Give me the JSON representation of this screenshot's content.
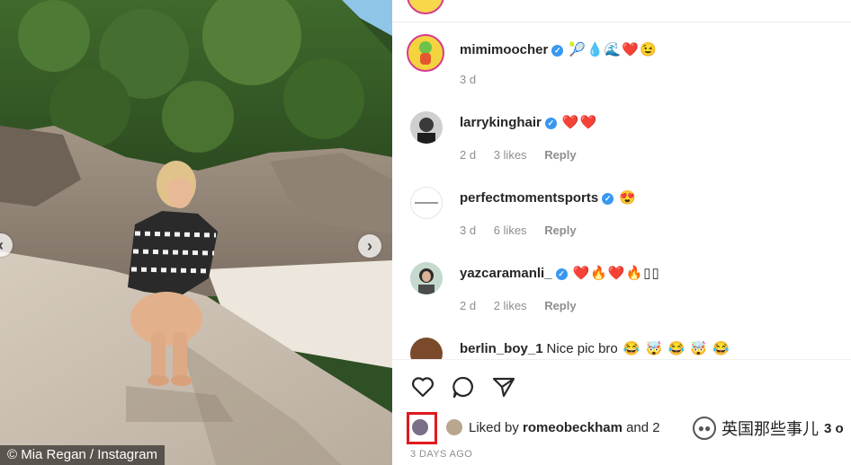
{
  "photo": {
    "watermark": "© Mia Regan / Instagram",
    "nav_left": "‹",
    "nav_right": "›"
  },
  "comments": [
    {
      "username": "mimimoocher",
      "verified": true,
      "text": "",
      "emojis": "🎾💧🌊❤️😉",
      "time": "3 d",
      "likes": "",
      "reply": ""
    },
    {
      "username": "larrykinghair",
      "verified": true,
      "text": "",
      "emojis": "❤️❤️",
      "time": "2 d",
      "likes": "3 likes",
      "reply": "Reply"
    },
    {
      "username": "perfectmomentsports",
      "verified": true,
      "text": "",
      "emojis": "😍",
      "time": "3 d",
      "likes": "6 likes",
      "reply": "Reply"
    },
    {
      "username": "yazcaramanli_",
      "verified": true,
      "text": "",
      "emojis": "❤️🔥❤️🔥▯▯",
      "time": "2 d",
      "likes": "2 likes",
      "reply": "Reply"
    },
    {
      "username": "berlin_boy_1",
      "verified": false,
      "text": "Nice pic bro",
      "emojis": "😂 🤯 😂 🤯 😂",
      "time": "",
      "likes": "",
      "reply": ""
    }
  ],
  "likes": {
    "prefix": "Liked by ",
    "user": "romeobeckham",
    "suffix": " and 2",
    "tail": "3 o"
  },
  "overlay_watermark": "英国那些事儿",
  "timestamp": "3 DAYS AGO",
  "icons": [
    "heart-icon",
    "comment-icon",
    "share-icon",
    "verified-badge-icon",
    "wechat-logo-icon"
  ],
  "colors": {
    "verified": "#3897f0",
    "highlight_box": "#e0191f",
    "meta_text": "#8e8e8e"
  }
}
